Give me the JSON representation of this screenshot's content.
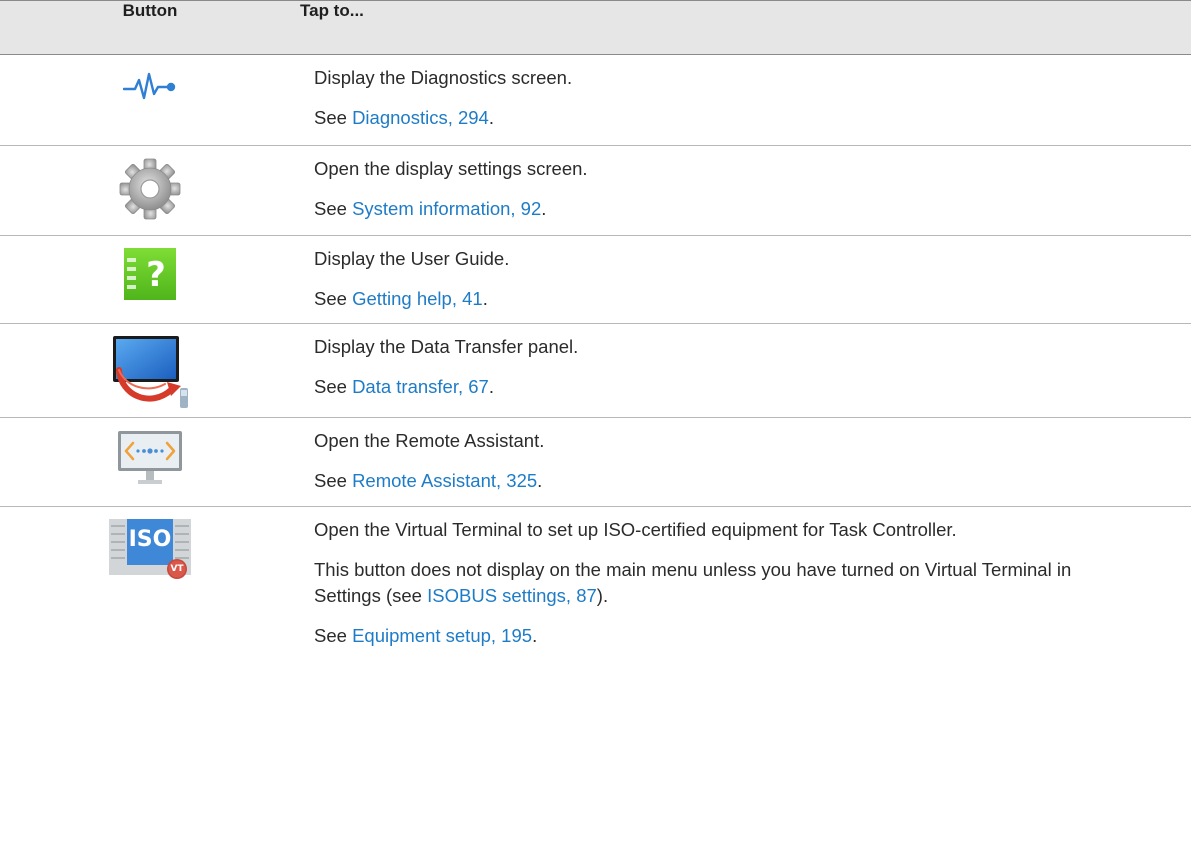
{
  "header": {
    "button_col": "Button",
    "tap_col": "Tap to..."
  },
  "rows": [
    {
      "icon": "diagnostics-pulse-icon",
      "action": "Display the Diagnostics screen.",
      "see_prefix": "See ",
      "see_link": "Diagnostics, 294",
      "see_suffix": "."
    },
    {
      "icon": "gear-icon",
      "action": "Open the display settings screen.",
      "see_prefix": "See ",
      "see_link": "System information, 92",
      "see_suffix": "."
    },
    {
      "icon": "help-guide-icon",
      "action": "Display the User Guide.",
      "see_prefix": "See ",
      "see_link": "Getting help, 41",
      "see_suffix": "."
    },
    {
      "icon": "data-transfer-icon",
      "action": "Display the Data Transfer panel.",
      "see_prefix": "See ",
      "see_link": "Data transfer, 67",
      "see_suffix": "."
    },
    {
      "icon": "remote-assistant-icon",
      "action": "Open the Remote Assistant.",
      "see_prefix": "See ",
      "see_link": "Remote Assistant, 325",
      "see_suffix": "."
    },
    {
      "icon": "iso-virtual-terminal-icon",
      "icon_text": "ISO",
      "icon_badge": "VT",
      "action": "Open the Virtual Terminal to set up ISO-certified equipment for Task Controller.",
      "note_prefix": "This button does not display on the main menu unless you have turned on Virtual Terminal in Settings (see ",
      "note_link": "ISOBUS settings, 87",
      "note_suffix": ").",
      "see_prefix": "See ",
      "see_link": "Equipment setup, 195",
      "see_suffix": "."
    }
  ],
  "colors": {
    "link": "#1e7cc7",
    "header_bg": "#e6e6e6",
    "help_icon_green": "#6ccf2a",
    "iso_blue": "#3f88d8"
  }
}
